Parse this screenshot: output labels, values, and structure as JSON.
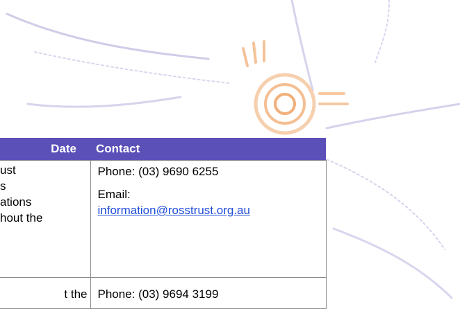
{
  "colors": {
    "header_bg": "#5b4fb8",
    "header_text": "#ffffff",
    "link": "#1f4ed8",
    "border": "#8b8b8b",
    "sun_orange": "#f2a15c",
    "swirl_lavender": "#b4b0e0"
  },
  "table": {
    "headers": [
      "Date",
      "Contact"
    ],
    "rows": [
      {
        "left_lines": [
          "ust",
          "s",
          "ations",
          "hout the"
        ],
        "phone": "Phone: (03) 9690 6255",
        "email_label": "Email:",
        "email": "information@rosstrust.org.au"
      },
      {
        "left_partial": "t the",
        "phone_partial": "Phone: (03) 9694 3199"
      }
    ]
  }
}
